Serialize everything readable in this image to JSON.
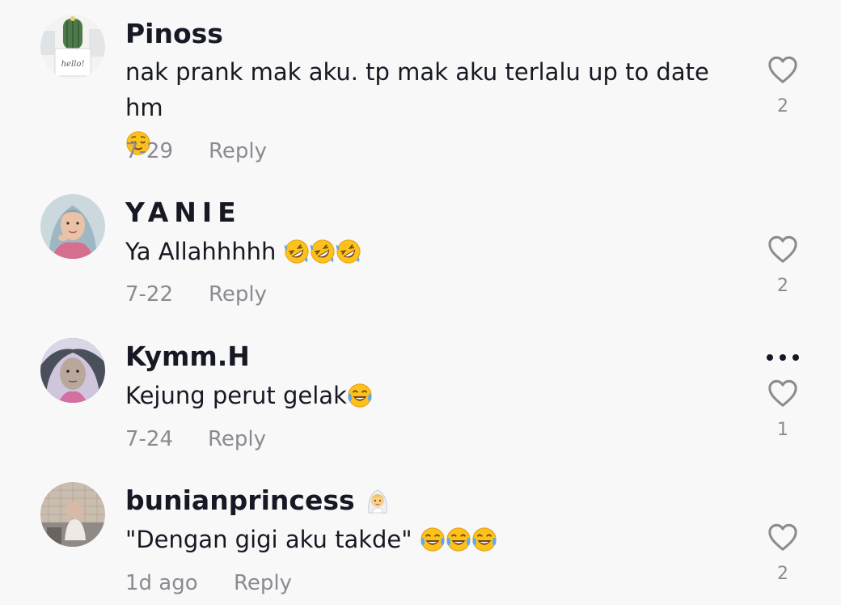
{
  "comments": [
    {
      "username": "Pinoss",
      "text": "nak prank mak aku. tp mak aku terlalu up to date hm",
      "emoji": "relieved-face",
      "date": "7-29",
      "reply_label": "Reply",
      "likes": "2",
      "avatar_label": "hello!"
    },
    {
      "username": "YANIE",
      "text": "Ya Allahhhhh",
      "emoji": "rolling-on-floor-laughing x3",
      "date": "7-22",
      "reply_label": "Reply",
      "likes": "2"
    },
    {
      "username": "Kymm.H",
      "text": "Kejung perut gelak",
      "emoji": "face-with-tears-of-joy",
      "date": "7-24",
      "reply_label": "Reply",
      "likes": "1",
      "more_icon": "more-options-icon"
    },
    {
      "username": "bunianprincess",
      "username_emoji": "person-with-veil",
      "text": "\"Dengan gigi aku takde\"",
      "emoji": "face-with-tears-of-joy x3",
      "date": "1d ago",
      "reply_label": "Reply",
      "likes": "2"
    }
  ],
  "colors": {
    "background": "#f8f8f8",
    "primary_text": "#161823",
    "secondary_text": "#8a8b91"
  }
}
